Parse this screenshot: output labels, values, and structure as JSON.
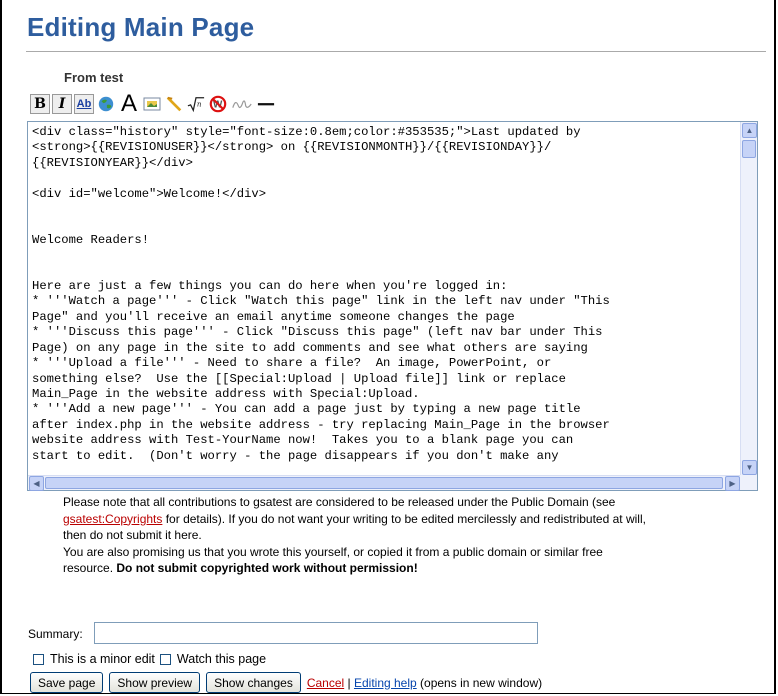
{
  "page": {
    "title": "Editing Main Page",
    "from_label": "From test"
  },
  "toolbar": {
    "buttons": [
      "bold-icon",
      "italic-icon",
      "internal-link-icon",
      "external-link-icon",
      "headline-icon",
      "image-icon",
      "media-icon",
      "math-icon",
      "nowiki-icon",
      "signature-icon",
      "horizontal-line-icon"
    ],
    "bold_glyph": "B",
    "italic_glyph": "I",
    "link_glyph": "Ab",
    "headline_glyph": "A"
  },
  "editor": {
    "text": "<div class=\"history\" style=\"font-size:0.8em;color:#353535;\">Last updated by\n<strong>{{REVISIONUSER}}</strong> on {{REVISIONMONTH}}/{{REVISIONDAY}}/\n{{REVISIONYEAR}}</div>\n\n<div id=\"welcome\">Welcome!</div>\n\n\nWelcome Readers!\n\n\nHere are just a few things you can do here when you're logged in:\n* '''Watch a page''' - Click \"Watch this page\" link in the left nav under \"This\nPage\" and you'll receive an email anytime someone changes the page\n* '''Discuss this page''' - Click \"Discuss this page\" (left nav bar under This\nPage) on any page in the site to add comments and see what others are saying\n* '''Upload a file''' - Need to share a file?  An image, PowerPoint, or\nsomething else?  Use the [[Special:Upload | Upload file]] link or replace\nMain_Page in the website address with Special:Upload.\n* '''Add a new page''' - You can add a page just by typing a new page title\nafter index.php in the website address - try replacing Main_Page in the browser\nwebsite address with Test-YourName now!  Takes you to a blank page you can\nstart to edit.  (Don't worry - the page disappears if you don't make any"
  },
  "notice": {
    "line1_a": "Please note that all contributions to gsatest are considered to be released under the Public Domain (see",
    "copyright_link": "gsatest:Copyrights",
    "line2_b": " for details). If you do not want your writing to be edited mercilessly and redistributed at will,",
    "line3": "then do not submit it here.",
    "line4": "You are also promising us that you wrote this yourself, or copied it from a public domain or similar free",
    "line5_a": "resource. ",
    "line5_bold": "Do not submit copyrighted work without permission!"
  },
  "form": {
    "summary_label": "Summary:",
    "summary_value": "",
    "minor_edit_label": "This is a minor edit",
    "watch_label": "Watch this page",
    "save_label": "Save page",
    "preview_label": "Show preview",
    "changes_label": "Show changes",
    "cancel_label": "Cancel",
    "separator": " | ",
    "help_label": "Editing help",
    "help_note": " (opens in new window)"
  },
  "colors": {
    "title": "#2e5d9e",
    "cancel_link": "#ba0000",
    "help_link": "#0645ad"
  }
}
